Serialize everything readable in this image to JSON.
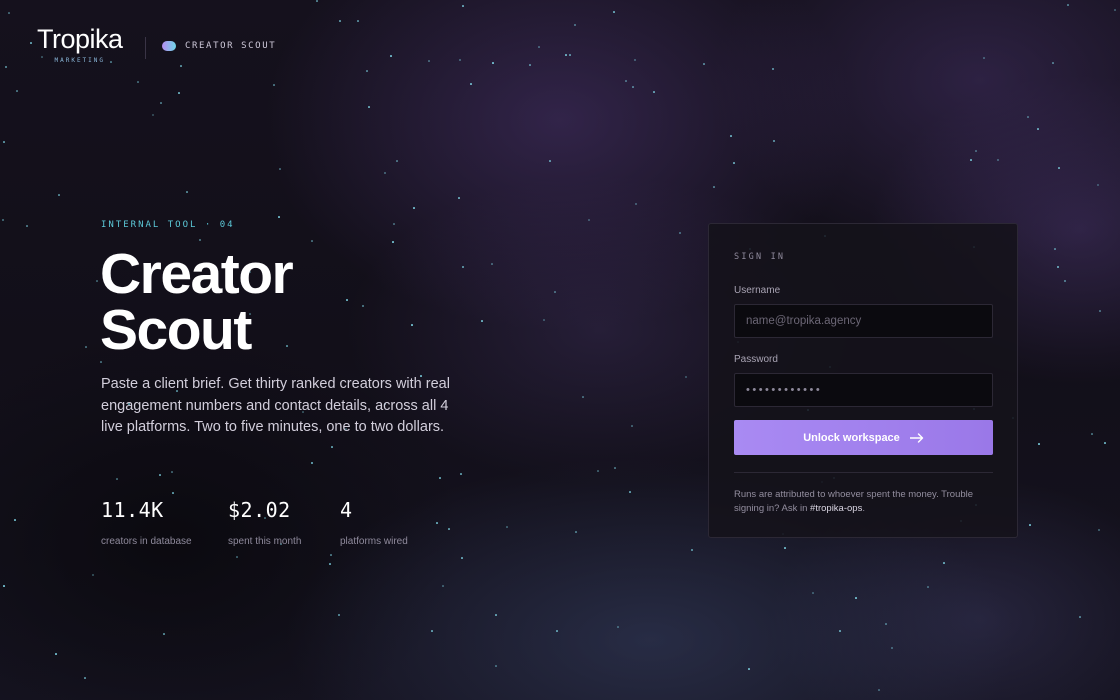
{
  "brand": {
    "name": "Tropika",
    "sub": "MARKETING"
  },
  "app": {
    "label": "CREATOR SCOUT"
  },
  "hero": {
    "eyebrow": "INTERNAL TOOL · 04",
    "title_line1": "Creator",
    "title_line2": "Scout",
    "description": "Paste a client brief. Get thirty ranked creators with real engagement numbers and contact details, across all 4 live platforms. Two to five minutes, one to two dollars."
  },
  "stats": [
    {
      "value": "11.4K",
      "label": "creators in database"
    },
    {
      "value": "$2.02",
      "label": "spent this month"
    },
    {
      "value": "4",
      "label": "platforms wired"
    }
  ],
  "signin": {
    "heading": "SIGN IN",
    "username_label": "Username",
    "username_placeholder": "name@tropika.agency",
    "password_label": "Password",
    "password_value": "••••••••••••",
    "submit_label": "Unlock workspace",
    "note_text": "Runs are attributed to whoever spent the money. Trouble signing in? Ask in ",
    "note_channel": "#tropika-ops",
    "note_end": "."
  },
  "colors": {
    "accent": "#9b7bea",
    "teal": "#5cc9d8",
    "background": "#120f19"
  },
  "icons": {
    "submit_icon": "arrow-right-icon",
    "app_icon": "toggle-pill-icon"
  }
}
